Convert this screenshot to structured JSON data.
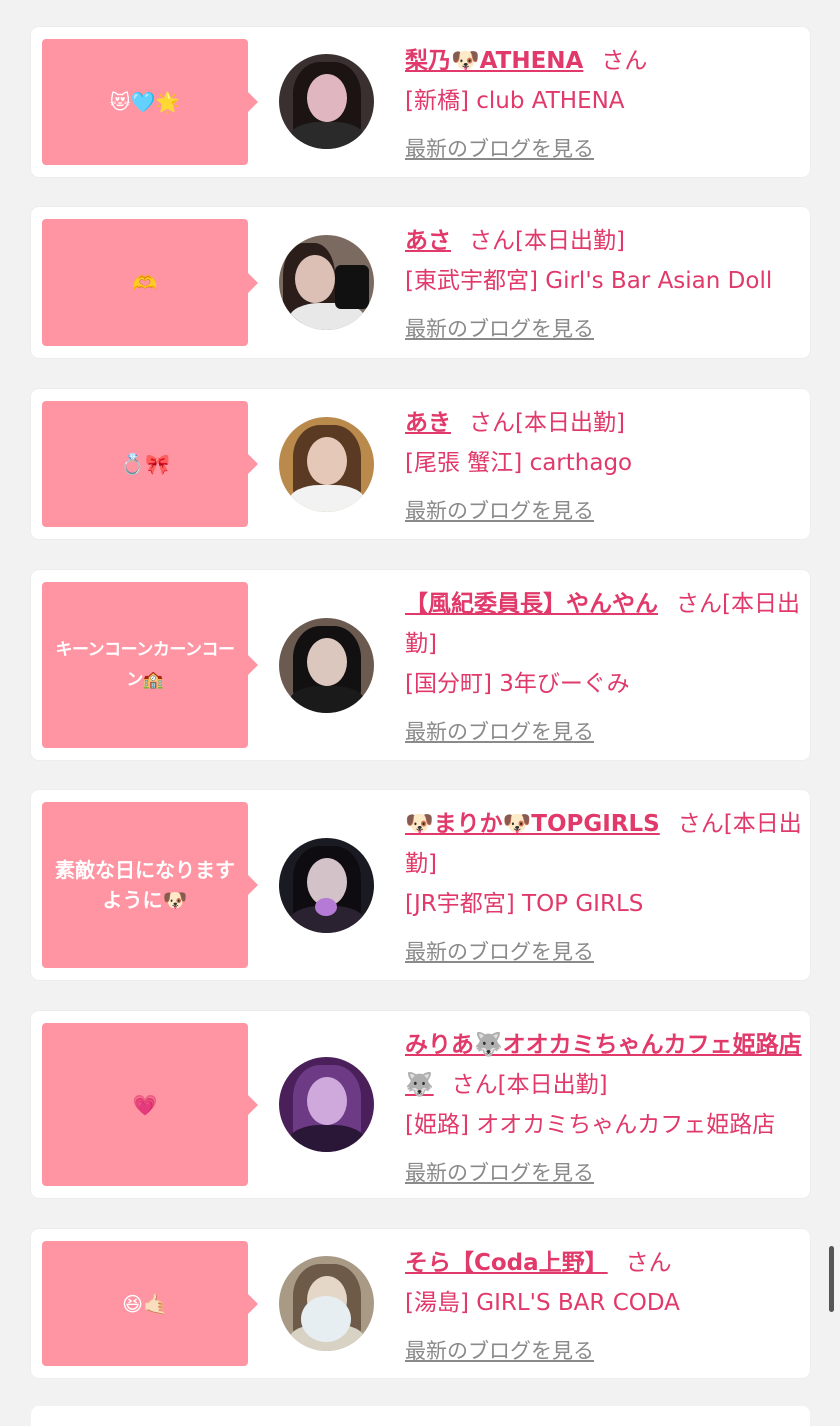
{
  "cards": [
    {
      "bubble": "😻🩵🌟",
      "name": "梨乃🐶ATHENA",
      "san": "さん",
      "shop": "[新橋] club ATHENA",
      "blog": "最新のブログを見る"
    },
    {
      "bubble": "🫶",
      "name": "あさ",
      "san": "さん[本日出勤]",
      "shop": "[東武宇都宮] Girl's Bar Asian Doll",
      "blog": "最新のブログを見る"
    },
    {
      "bubble": "💍🎀",
      "name": "あき",
      "san": "さん[本日出勤]",
      "shop": "[尾張 蟹江] carthago",
      "blog": "最新のブログを見る"
    },
    {
      "bubble": "キーンコーンカーンコーン🏫",
      "name": "【風紀委員長】やんやん",
      "san": "さん[本日出勤]",
      "shop": "[国分町] 3年びーぐみ",
      "blog": "最新のブログを見る"
    },
    {
      "bubble": "素敵な日になりますように🐶",
      "name": "🐶まりか🐶TOPGIRLS",
      "san": "さん[本日出勤]",
      "shop": "[JR宇都宮] TOP GIRLS",
      "blog": "最新のブログを見る"
    },
    {
      "bubble": "💗",
      "name": "みりあ🐺オオカミちゃんカフェ姫路店🐺",
      "san": "さん[本日出勤]",
      "shop": "[姫路] オオカミちゃんカフェ姫路店",
      "blog": "最新のブログを見る"
    },
    {
      "bubble": "😆🤙🏻",
      "name": "そら【Coda上野】",
      "san": "さん",
      "shop": "[湯島] GIRL'S BAR CODA",
      "blog": "最新のブログを見る"
    }
  ],
  "colors": {
    "accent": "#e0396a",
    "bubble": "#ff94a3",
    "background": "#f2f2f2",
    "link_gray": "#8a8a8a"
  }
}
